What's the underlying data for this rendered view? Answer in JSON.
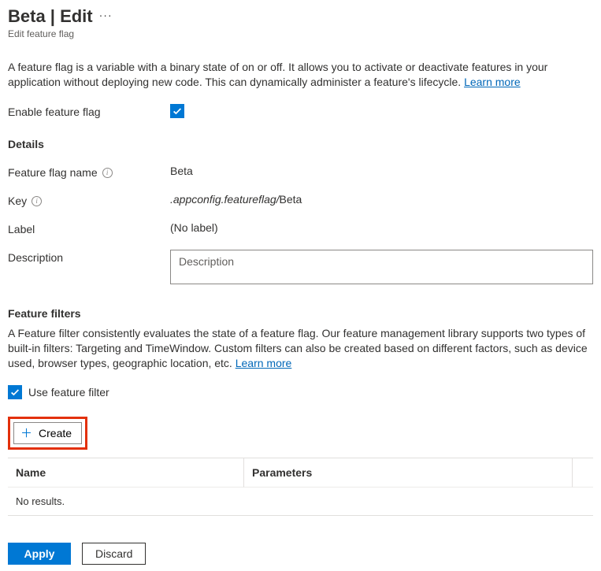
{
  "header": {
    "title": "Beta | Edit",
    "subtitle": "Edit feature flag"
  },
  "intro": {
    "text": "A feature flag is a variable with a binary state of on or off. It allows you to activate or deactivate features in your application without deploying new code. This can dynamically administer a feature's lifecycle.",
    "learn_more": "Learn more"
  },
  "enable_flag": {
    "label": "Enable feature flag",
    "checked": true
  },
  "details": {
    "heading": "Details",
    "name_label": "Feature flag name",
    "name_value": "Beta",
    "key_label": "Key",
    "key_prefix": ".appconfig.featureflag/",
    "key_value": "Beta",
    "label_label": "Label",
    "label_value": "(No label)",
    "description_label": "Description",
    "description_placeholder": "Description",
    "description_value": ""
  },
  "filters": {
    "heading": "Feature filters",
    "text": "A Feature filter consistently evaluates the state of a feature flag. Our feature management library supports two types of built-in filters: Targeting and TimeWindow. Custom filters can also be created based on different factors, such as device used, browser types, geographic location, etc.",
    "learn_more": "Learn more",
    "use_filter_label": "Use feature filter",
    "use_filter_checked": true,
    "create_label": "Create",
    "table": {
      "columns": [
        "Name",
        "Parameters"
      ],
      "empty_text": "No results."
    }
  },
  "footer": {
    "apply": "Apply",
    "discard": "Discard"
  }
}
